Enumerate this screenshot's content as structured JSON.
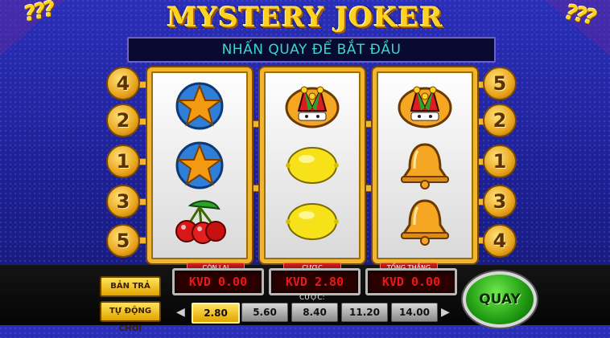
{
  "game": {
    "title": "MYSTERY JOKER",
    "corner_left": "???",
    "corner_right": "???",
    "message": "NHẤN QUAY ĐỂ BẮT ĐẦU"
  },
  "paylines": {
    "left": [
      "4",
      "2",
      "1",
      "3",
      "5"
    ],
    "right": [
      "5",
      "2",
      "1",
      "3",
      "4"
    ]
  },
  "reels": [
    [
      "star",
      "star",
      "cherry"
    ],
    [
      "joker",
      "lemon",
      "lemon"
    ],
    [
      "joker",
      "bell",
      "bell"
    ]
  ],
  "meters": {
    "balance": {
      "label": "CÒN LẠI",
      "value": "KVD 0.00"
    },
    "bet": {
      "label": "CƯỢC",
      "value": "KVD 2.80"
    },
    "total_win": {
      "label": "TỔNG THẮNG",
      "value": "KVD 0.00"
    }
  },
  "controls": {
    "paytable": "BẢN TRẢ",
    "autoplay": "TỰ ĐỘNG CHƠI",
    "bet_label": "CƯỢC:",
    "bet_options": [
      "2.80",
      "5.60",
      "8.40",
      "11.20",
      "14.00"
    ],
    "selected_bet": "2.80",
    "prev": "◀",
    "next": "▶",
    "spin": "QUAY"
  },
  "colors": {
    "background": "#1c1f8f",
    "gold": "#f2b530",
    "message_text": "#3ad6d2",
    "meter_text": "#e81818",
    "spin_green": "#1f9a12"
  }
}
